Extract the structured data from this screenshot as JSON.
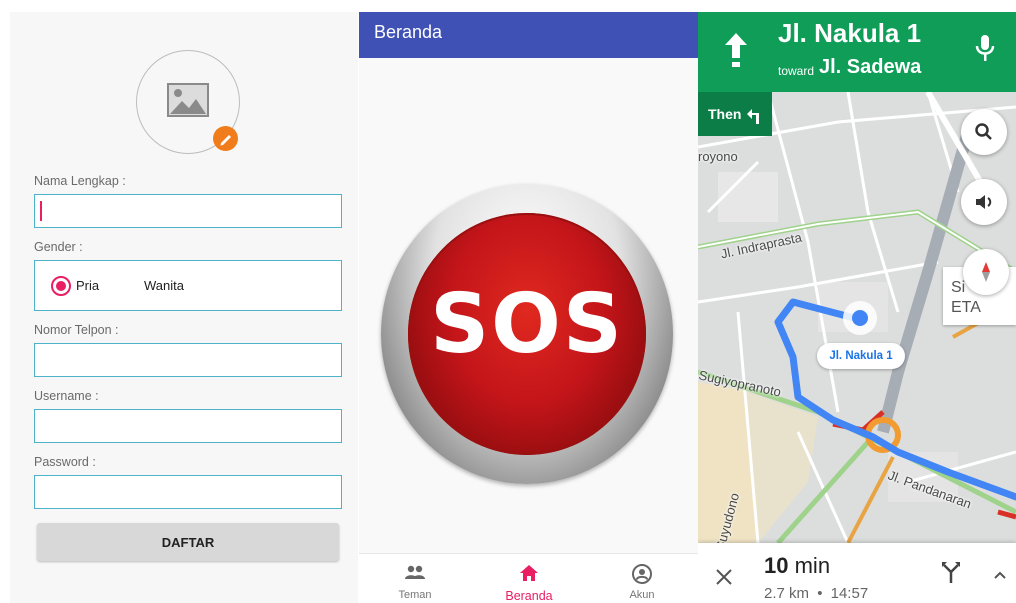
{
  "register": {
    "fields": [
      {
        "label": "Nama Lengkap :",
        "value": ""
      },
      {
        "label": "Gender :"
      },
      {
        "label": "Nomor Telpon :",
        "value": ""
      },
      {
        "label": "Username :",
        "value": ""
      },
      {
        "label": "Password :",
        "value": ""
      }
    ],
    "gender_options": [
      "Pria",
      "Wanita"
    ],
    "gender_selected": "Pria",
    "submit_label": "DAFTAR",
    "accent_color": "#e91e63",
    "badge_color": "#f07c1b"
  },
  "home": {
    "title": "Beranda",
    "sos_label": "SOS",
    "appbar_color": "#3f51b5",
    "nav": [
      {
        "label": "Teman",
        "icon": "people-icon"
      },
      {
        "label": "Beranda",
        "icon": "home-icon",
        "active": true
      },
      {
        "label": "Akun",
        "icon": "account-circle-icon"
      }
    ],
    "active_color": "#e91e63"
  },
  "navigation": {
    "current_street": "Jl. Nakula 1",
    "toward_label": "toward",
    "toward_street": "Jl. Sadewa",
    "then_label": "Then",
    "header_color": "#0f9d58",
    "map_labels": {
      "royono": "royono",
      "indraprasta": "Jl. Indraprasta",
      "sugiyopranoto": "Sugiyopranoto",
      "pandanaran": "Jl. Pandanaran",
      "suyudono": "Suyudono"
    },
    "destination_label": "Jl. Nakula 1",
    "eta_chip": [
      "Si",
      "ETA"
    ],
    "eta_minutes": "10",
    "eta_unit": "min",
    "distance": "2.7 km",
    "separator": "•",
    "arrival_time": "14:57",
    "route_color": "#4285f4"
  }
}
